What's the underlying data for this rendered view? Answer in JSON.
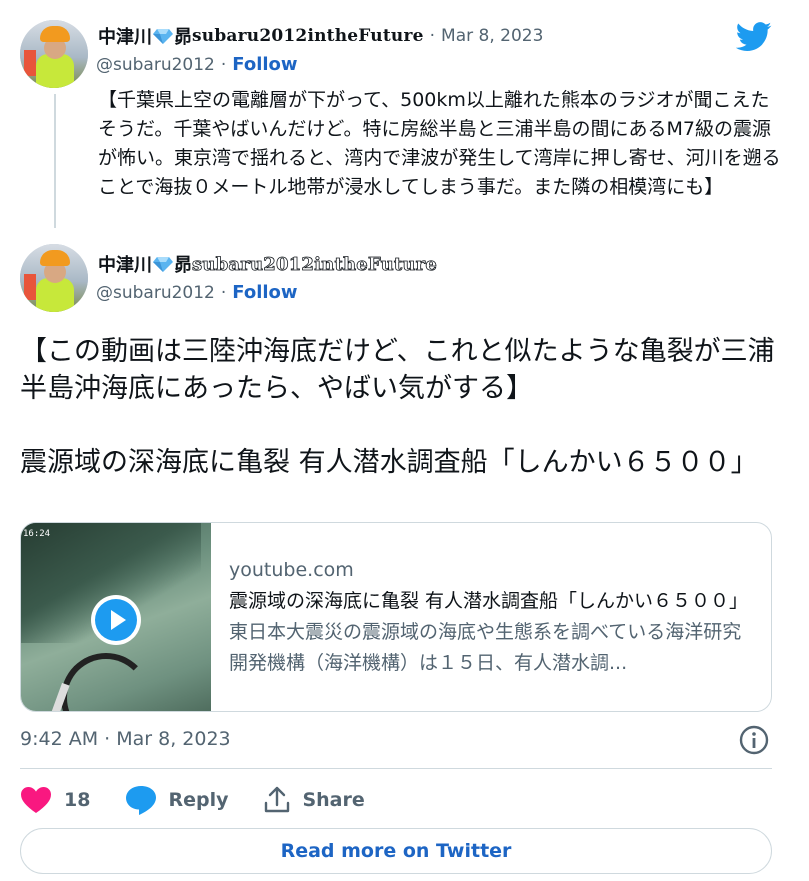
{
  "tweets": [
    {
      "display_name_jp": "中津川",
      "display_name_jp2": "昴",
      "display_name_latin": "subaru2012intheFuture",
      "handle": "@subaru2012",
      "date": "Mar 8, 2023",
      "follow_label": "Follow",
      "text": "【千葉県上空の電離層が下がって、500km以上離れた熊本のラジオが聞こえたそうだ。千葉やばいんだけど。特に房総半島と三浦半島の間にあるM7級の震源が怖い。東京湾で揺れると、湾内で津波が発生して湾岸に押し寄せ、河川を遡ることで海抜０メートル地帯が浸水してしまう事だ。また隣の相模湾にも】"
    },
    {
      "display_name_jp": "中津川",
      "display_name_jp2": "昴",
      "display_name_latin": "subaru2012intheFuture",
      "handle": "@subaru2012",
      "follow_label": "Follow",
      "text_p1": "【この動画は三陸沖海底だけど、これと似たような亀裂が三浦半島沖海底にあったら、やばい気がする】",
      "text_p2": "震源域の深海底に亀裂 有人潜水調査船「しんかい６５００」"
    }
  ],
  "card": {
    "timecode": "16:24",
    "domain": "youtube.com",
    "title": "震源域の深海底に亀裂 有人潜水調査船「しんかい６５００」",
    "description": "東日本大震災の震源域の海底や生態系を調べている海洋研究開発機構（海洋機構）は１５日、有人潜水調..."
  },
  "timestamp": "9:42 AM · Mar 8, 2023",
  "actions": {
    "like_count": "18",
    "reply_label": "Reply",
    "share_label": "Share"
  },
  "read_more_label": "Read more on Twitter",
  "colors": {
    "twitter_blue": "#1d9bf0",
    "link_blue": "#1d65c4",
    "heart_pink": "#f91880",
    "muted_text": "#536471"
  }
}
